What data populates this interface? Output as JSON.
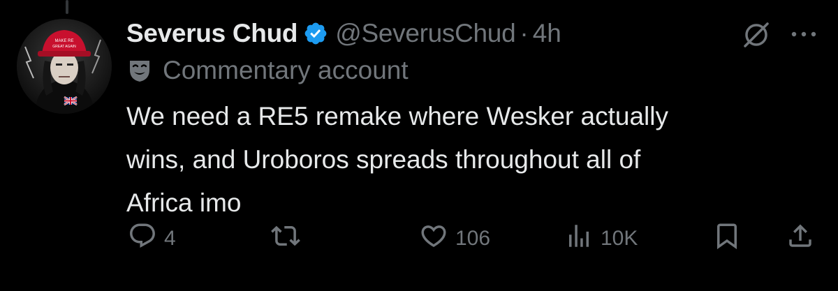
{
  "tweet": {
    "display_name": "Severus Chud",
    "handle": "@SeverusChud",
    "separator": "·",
    "time": "4h",
    "label": "Commentary account",
    "text_lines": [
      "We need a RE5 remake where Wesker actually",
      "wins, and Uroboros spreads throughout all of",
      "Africa imo"
    ],
    "avatar_hat_text": [
      "MAKE RE",
      "GREAT AGAIN"
    ]
  },
  "actions": {
    "replies": "4",
    "reposts": "",
    "likes": "106",
    "views": "10K"
  },
  "icons": {
    "verified": "verified-badge-icon",
    "grok": "grok-icon",
    "more": "more-icon",
    "label": "theater-masks-icon",
    "reply": "reply-icon",
    "repost": "repost-icon",
    "like": "heart-icon",
    "views": "views-icon",
    "bookmark": "bookmark-icon",
    "share": "share-icon"
  },
  "colors": {
    "background": "#000000",
    "text": "#e7e9ea",
    "secondary": "#71767b",
    "verified": "#1d9bf0",
    "hat": "#c8102e"
  }
}
